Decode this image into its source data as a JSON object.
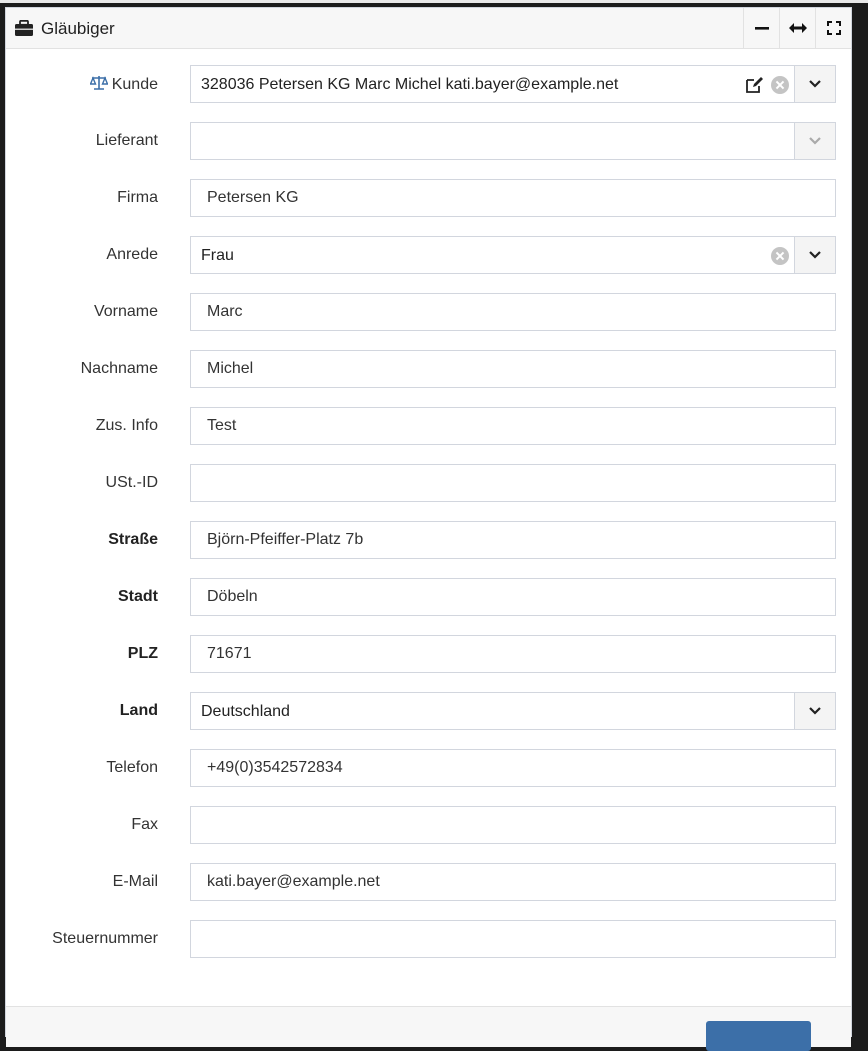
{
  "panel": {
    "title": "Gläubiger",
    "title_icon": "briefcase-icon",
    "tools": [
      "minimize-icon",
      "expand-horizontal-icon",
      "fullscreen-icon"
    ]
  },
  "form": {
    "kunde": {
      "label": "Kunde",
      "icon": "scale-icon",
      "value": "328036 Petersen KG Marc Michel kati.bayer@example.net"
    },
    "lieferant": {
      "label": "Lieferant",
      "value": ""
    },
    "firma": {
      "label": "Firma",
      "value": "Petersen KG"
    },
    "anrede": {
      "label": "Anrede",
      "value": "Frau"
    },
    "vorname": {
      "label": "Vorname",
      "value": "Marc"
    },
    "nachname": {
      "label": "Nachname",
      "value": "Michel"
    },
    "zusinfo": {
      "label": "Zus. Info",
      "value": "Test"
    },
    "ustid": {
      "label": "USt.-ID",
      "value": ""
    },
    "strasse": {
      "label": "Straße",
      "value": "Björn-Pfeiffer-Platz 7b"
    },
    "stadt": {
      "label": "Stadt",
      "value": "Döbeln"
    },
    "plz": {
      "label": "PLZ",
      "value": "71671"
    },
    "land": {
      "label": "Land",
      "value": "Deutschland"
    },
    "telefon": {
      "label": "Telefon",
      "value": "+49(0)3542572834"
    },
    "fax": {
      "label": "Fax",
      "value": ""
    },
    "email": {
      "label": "E-Mail",
      "value": "kati.bayer@example.net"
    },
    "steuernummer": {
      "label": "Steuernummer",
      "value": ""
    }
  },
  "colors": {
    "accent": "#3c6fa8",
    "border": "#d2d6de",
    "header_bg": "#f7f7f7"
  }
}
